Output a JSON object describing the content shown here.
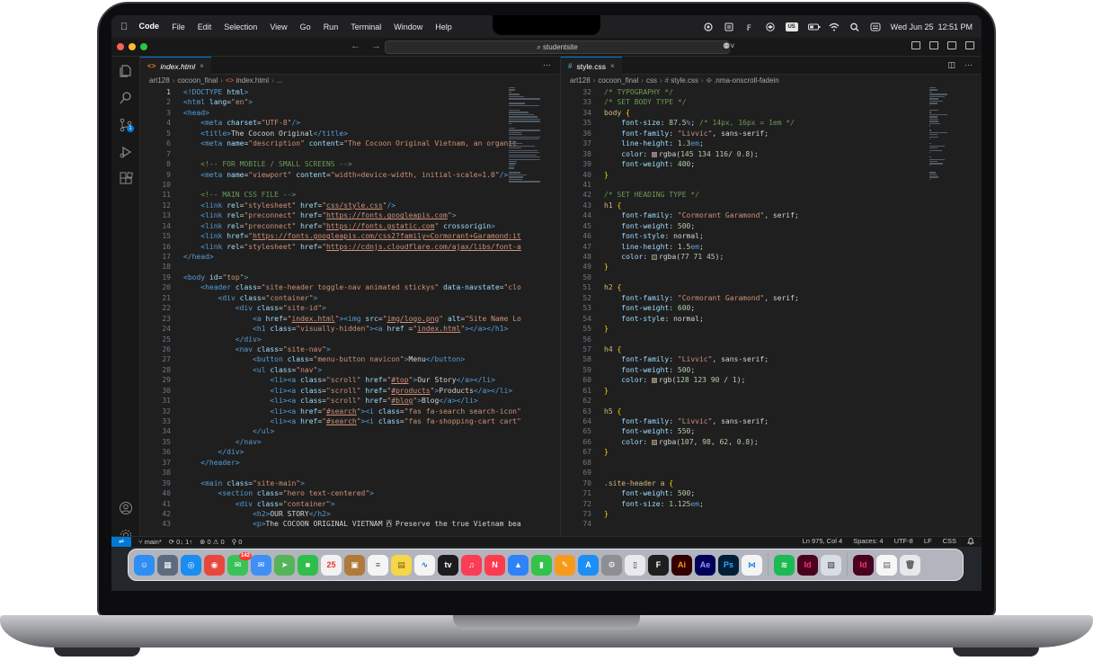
{
  "menubar": {
    "app_name": "Code",
    "menus": [
      "File",
      "Edit",
      "Selection",
      "View",
      "Go",
      "Run",
      "Terminal",
      "Window",
      "Help"
    ],
    "input_source": "US",
    "datetime": "Wed Jun 25  12:51 PM"
  },
  "titlebar": {
    "search_text": "studentsite",
    "back_glyph": "←",
    "forward_glyph": "→"
  },
  "left_editor": {
    "tab_label": "index.html",
    "tab_close": "×",
    "breadcrumb": [
      "art128",
      "cocoon_final",
      "index.html",
      "..."
    ],
    "current_line": 1,
    "lines": [
      {
        "n": 1,
        "html": "<span class='tg'>&lt;!DOCTYPE</span> <span class='at'>html</span><span class='tg'>&gt;</span>"
      },
      {
        "n": 2,
        "html": "<span class='tg'>&lt;html</span> <span class='at'>lang</span>=<span class='vs'>\"en\"</span><span class='tg'>&gt;</span>"
      },
      {
        "n": 3,
        "html": "<span class='tg'>&lt;head&gt;</span>"
      },
      {
        "n": 4,
        "html": "    <span class='tg'>&lt;meta</span> <span class='at'>charset</span>=<span class='vs'>\"UTF-8\"</span><span class='tg'>/&gt;</span>"
      },
      {
        "n": 5,
        "html": "    <span class='tg'>&lt;title&gt;</span>The Cocoon Original<span class='tg'>&lt;/title&gt;</span>"
      },
      {
        "n": 6,
        "html": "    <span class='tg'>&lt;meta</span> <span class='at'>name</span>=<span class='vs'>\"description\"</span> <span class='at'>content</span>=<span class='vs'>\"The Cocoon Original Vietnam, an organic</span>"
      },
      {
        "n": 7,
        "html": ""
      },
      {
        "n": 8,
        "html": "    <span class='cm'>&lt;!-- FOR MOBILE / SMALL SCREENS --&gt;</span>"
      },
      {
        "n": 9,
        "html": "    <span class='tg'>&lt;meta</span> <span class='at'>name</span>=<span class='vs'>\"viewport\"</span> <span class='at'>content</span>=<span class='vs'>\"width=device-width, initial-scale=1.0\"</span><span class='tg'>/&gt;</span>"
      },
      {
        "n": 10,
        "html": ""
      },
      {
        "n": 11,
        "html": "    <span class='cm'>&lt;!-- MAIN CSS FILE --&gt;</span>"
      },
      {
        "n": 12,
        "html": "    <span class='tg'>&lt;link</span> <span class='at'>rel</span>=<span class='vs'>\"stylesheet\"</span> <span class='at'>href</span>=<span class='vs'>\"<u>css/style.css</u>\"</span><span class='tg'>/&gt;</span>"
      },
      {
        "n": 13,
        "html": "    <span class='tg'>&lt;link</span> <span class='at'>rel</span>=<span class='vs'>\"preconnect\"</span> <span class='at'>href</span>=<span class='vs'>\"<u>https://fonts.googleapis.com</u>\"</span><span class='tg'>&gt;</span>"
      },
      {
        "n": 14,
        "html": "    <span class='tg'>&lt;link</span> <span class='at'>rel</span>=<span class='vs'>\"preconnect\"</span> <span class='at'>href</span>=<span class='vs'>\"<u>https://fonts.gstatic.com</u>\"</span> <span class='at'>crossorigin</span><span class='tg'>&gt;</span>"
      },
      {
        "n": 15,
        "html": "    <span class='tg'>&lt;link</span> <span class='at'>href</span>=<span class='vs'>\"<u>https://fonts.googleapis.com/css2?family=Cormorant+Garamond:it</u></span>"
      },
      {
        "n": 16,
        "html": "    <span class='tg'>&lt;link</span> <span class='at'>rel</span>=<span class='vs'>\"stylesheet\"</span> <span class='at'>href</span>=<span class='vs'>\"<u>https://cdnjs.cloudflare.com/ajax/libs/font-a</u></span>"
      },
      {
        "n": 17,
        "html": "<span class='tg'>&lt;/head&gt;</span>"
      },
      {
        "n": 18,
        "html": ""
      },
      {
        "n": 19,
        "html": "<span class='tg'>&lt;body</span> <span class='at'>id</span>=<span class='vs'>\"top\"</span><span class='tg'>&gt;</span>"
      },
      {
        "n": 20,
        "html": "    <span class='tg'>&lt;header</span> <span class='at'>class</span>=<span class='vs'>\"site-header toggle-nav animated stickys\"</span> <span class='at'>data-navstate</span>=<span class='vs'>\"clo</span>"
      },
      {
        "n": 21,
        "html": "        <span class='tg'>&lt;div</span> <span class='at'>class</span>=<span class='vs'>\"container\"</span><span class='tg'>&gt;</span>"
      },
      {
        "n": 22,
        "html": "            <span class='tg'>&lt;div</span> <span class='at'>class</span>=<span class='vs'>\"site-id\"</span><span class='tg'>&gt;</span>"
      },
      {
        "n": 23,
        "html": "                <span class='tg'>&lt;a</span> <span class='at'>href</span>=<span class='vs'>\"<u>index.html</u>\"</span><span class='tg'>&gt;&lt;img</span> <span class='at'>src</span>=<span class='vs'>\"<u>img/logo.png</u>\"</span> <span class='at'>alt</span>=<span class='vs'>\"Site Name Lo</span>"
      },
      {
        "n": 24,
        "html": "                <span class='tg'>&lt;h1</span> <span class='at'>class</span>=<span class='vs'>\"visually-hidden\"</span><span class='tg'>&gt;&lt;a</span> <span class='at'>href</span> =<span class='vs'>\"<u>index.html</u>\"</span><span class='tg'>&gt;&lt;/a&gt;&lt;/h1&gt;</span>"
      },
      {
        "n": 25,
        "html": "            <span class='tg'>&lt;/div&gt;</span>"
      },
      {
        "n": 26,
        "html": "            <span class='tg'>&lt;nav</span> <span class='at'>class</span>=<span class='vs'>\"site-nav\"</span><span class='tg'>&gt;</span>"
      },
      {
        "n": 27,
        "html": "                <span class='tg'>&lt;button</span> <span class='at'>class</span>=<span class='vs'>\"menu-button navicon\"</span><span class='tg'>&gt;</span>Menu<span class='tg'>&lt;/button&gt;</span>"
      },
      {
        "n": 28,
        "html": "                <span class='tg'>&lt;ul</span> <span class='at'>class</span>=<span class='vs'>\"nav\"</span><span class='tg'>&gt;</span>"
      },
      {
        "n": 29,
        "html": "                    <span class='tg'>&lt;li&gt;&lt;a</span> <span class='at'>class</span>=<span class='vs'>\"scroll\"</span> <span class='at'>href</span>=<span class='vs'>\"<u>#top</u>\"</span><span class='tg'>&gt;</span>Our Story<span class='tg'>&lt;/a&gt;&lt;/li&gt;</span>"
      },
      {
        "n": 30,
        "html": "                    <span class='tg'>&lt;li&gt;&lt;a</span> <span class='at'>class</span>=<span class='vs'>\"scroll\"</span> <span class='at'>href</span>=<span class='vs'>\"<u>#products</u>\"</span><span class='tg'>&gt;</span>Products<span class='tg'>&lt;/a&gt;&lt;/li&gt;</span>"
      },
      {
        "n": 31,
        "html": "                    <span class='tg'>&lt;li&gt;&lt;a</span> <span class='at'>class</span>=<span class='vs'>\"scroll\"</span> <span class='at'>href</span>=<span class='vs'>\"<u>#blog</u>\"</span><span class='tg'>&gt;</span>Blog<span class='tg'>&lt;/a&gt;&lt;/li&gt;</span>"
      },
      {
        "n": 32,
        "html": "                    <span class='tg'>&lt;li&gt;&lt;a</span> <span class='at'>href</span>=<span class='vs'>\"<u>#search</u>\"</span><span class='tg'>&gt;&lt;i</span> <span class='at'>class</span>=<span class='vs'>\"fas fa-search search-icon\"</span>"
      },
      {
        "n": 33,
        "html": "                    <span class='tg'>&lt;li&gt;&lt;a</span> <span class='at'>href</span>=<span class='vs'>\"<u>#search</u>\"</span><span class='tg'>&gt;&lt;i</span> <span class='at'>class</span>=<span class='vs'>\"fas fa-shopping-cart cart\"</span>"
      },
      {
        "n": 34,
        "html": "                <span class='tg'>&lt;/ul&gt;</span>"
      },
      {
        "n": 35,
        "html": "            <span class='tg'>&lt;/nav&gt;</span>"
      },
      {
        "n": 36,
        "html": "        <span class='tg'>&lt;/div&gt;</span>"
      },
      {
        "n": 37,
        "html": "    <span class='tg'>&lt;/header&gt;</span>"
      },
      {
        "n": 38,
        "html": ""
      },
      {
        "n": 39,
        "html": "    <span class='tg'>&lt;main</span> <span class='at'>class</span>=<span class='vs'>\"site-main\"</span><span class='tg'>&gt;</span>"
      },
      {
        "n": 40,
        "html": "        <span class='tg'>&lt;section</span> <span class='at'>class</span>=<span class='vs'>\"hero text-centered\"</span><span class='tg'>&gt;</span>"
      },
      {
        "n": 41,
        "html": "            <span class='tg'>&lt;div</span> <span class='at'>class</span>=<span class='vs'>\"container\"</span><span class='tg'>&gt;</span>"
      },
      {
        "n": 42,
        "html": "                <span class='tg'>&lt;h2&gt;</span>OUR STORY<span class='tg'>&lt;/h2&gt;</span>"
      },
      {
        "n": 43,
        "html": "                <span class='tg'>&lt;p&gt;</span>The COCOON ORIGINAL VIETNAM ⍓ Preserve the true Vietnam bea"
      }
    ]
  },
  "right_editor": {
    "tab_label": "style.css",
    "tab_close": "×",
    "breadcrumb": [
      "art128",
      "cocoon_final",
      "css",
      "style.css",
      ".nma-onscroll-fadein"
    ],
    "lines": [
      {
        "n": 32,
        "html": "<span class='cm'>/* TYPOGRAPHY */</span>"
      },
      {
        "n": 33,
        "html": "<span class='cm'>/* SET BODY TYPE */</span>"
      },
      {
        "n": 34,
        "html": "<span class='sel'>body</span> <span class='brace'>{</span>"
      },
      {
        "n": 35,
        "html": "    <span class='pr'>font-size</span>: <span class='nm'>87.5</span><span class='un'>%</span>; <span class='cm'>/* 14px, 16px = 1em */</span>"
      },
      {
        "n": 36,
        "html": "    <span class='pr'>font-family</span>: <span class='vs'>\"Livvic\"</span>, <span class='kw'>sans-serif</span>;"
      },
      {
        "n": 37,
        "html": "    <span class='pr'>line-height</span>: <span class='nm'>1.3</span><span class='un'>em</span>;"
      },
      {
        "n": 38,
        "html": "    <span class='pr'>color</span>: <span class='swatch' style='background:#917474'></span><span class='kw'>rgba</span>(<span class='nm'>145 134 116</span>/ <span class='nm'>0.8</span>);"
      },
      {
        "n": 39,
        "html": "    <span class='pr'>font-weight</span>: <span class='nm'>400</span>;"
      },
      {
        "n": 40,
        "html": "<span class='brace'>}</span>"
      },
      {
        "n": 41,
        "html": ""
      },
      {
        "n": 42,
        "html": "<span class='cm'>/* SET HEADING TYPE */</span>"
      },
      {
        "n": 43,
        "html": "<span class='sel'>h1</span> <span class='brace'>{</span>"
      },
      {
        "n": 44,
        "html": "    <span class='pr'>font-family</span>: <span class='vs'>\"Cormorant Garamond\"</span>, <span class='kw'>serif</span>;"
      },
      {
        "n": 45,
        "html": "    <span class='pr'>font-weight</span>: <span class='nm'>500</span>;"
      },
      {
        "n": 46,
        "html": "    <span class='pr'>font-style</span>: <span class='kw'>normal</span>;"
      },
      {
        "n": 47,
        "html": "    <span class='pr'>line-height</span>: <span class='nm'>1.5</span><span class='un'>em</span>;"
      },
      {
        "n": 48,
        "html": "    <span class='pr'>color</span>: <span class='swatch' style='background:#4d472d'></span><span class='kw'>rgba</span>(<span class='nm'>77 71 45</span>);"
      },
      {
        "n": 49,
        "html": "<span class='brace'>}</span>"
      },
      {
        "n": 50,
        "html": ""
      },
      {
        "n": 51,
        "html": "<span class='sel'>h2</span> <span class='brace'>{</span>"
      },
      {
        "n": 52,
        "html": "    <span class='pr'>font-family</span>: <span class='vs'>\"Cormorant Garamond\"</span>, <span class='kw'>serif</span>;"
      },
      {
        "n": 53,
        "html": "    <span class='pr'>font-weight</span>: <span class='nm'>600</span>;"
      },
      {
        "n": 54,
        "html": "    <span class='pr'>font-style</span>: <span class='kw'>normal</span>;"
      },
      {
        "n": 55,
        "html": "<span class='brace'>}</span>"
      },
      {
        "n": 56,
        "html": ""
      },
      {
        "n": 57,
        "html": "<span class='sel'>h4</span> <span class='brace'>{</span>"
      },
      {
        "n": 58,
        "html": "    <span class='pr'>font-family</span>: <span class='vs'>\"Livvic\"</span>, <span class='kw'>sans-serif</span>;"
      },
      {
        "n": 59,
        "html": "    <span class='pr'>font-weight</span>: <span class='nm'>500</span>;"
      },
      {
        "n": 60,
        "html": "    <span class='pr'>color</span>: <span class='swatch' style='background:#807b5a'></span><span class='kw'>rgb</span>(<span class='nm'>128 123 90</span> / <span class='nm'>1</span>);"
      },
      {
        "n": 61,
        "html": "<span class='brace'>}</span>"
      },
      {
        "n": 62,
        "html": ""
      },
      {
        "n": 63,
        "html": "<span class='sel'>h5</span> <span class='brace'>{</span>"
      },
      {
        "n": 64,
        "html": "    <span class='pr'>font-family</span>: <span class='vs'>\"Livvic\"</span>, <span class='kw'>sans-serif</span>;"
      },
      {
        "n": 65,
        "html": "    <span class='pr'>font-weight</span>: <span class='nm'>550</span>;"
      },
      {
        "n": 66,
        "html": "    <span class='pr'>color</span>: <span class='swatch' style='background:#6b623e'></span><span class='kw'>rgba</span>(<span class='nm'>107</span>, <span class='nm'>98</span>, <span class='nm'>62</span>, <span class='nm'>0.8</span>);"
      },
      {
        "n": 67,
        "html": "<span class='brace'>}</span>"
      },
      {
        "n": 68,
        "html": ""
      },
      {
        "n": 69,
        "html": ""
      },
      {
        "n": 70,
        "html": "<span class='sel'>.site-header a</span> <span class='brace'>{</span>"
      },
      {
        "n": 71,
        "html": "    <span class='pr'>font-weight</span>: <span class='nm'>500</span>;"
      },
      {
        "n": 72,
        "html": "    <span class='pr'>font-size</span>: <span class='nm'>1.125</span><span class='un'>em</span>;"
      },
      {
        "n": 73,
        "html": "<span class='brace'>}</span>"
      },
      {
        "n": 74,
        "html": ""
      }
    ]
  },
  "statusbar": {
    "remote": "⇌",
    "branch": "main*",
    "sync": "⟳ 0↓ 1↑",
    "problems": "⊗ 0 ⚠ 0",
    "ports": "⚲ 0",
    "cursor": "Ln 975, Col 4",
    "spaces": "Spaces: 4",
    "encoding": "UTF-8",
    "eol": "LF",
    "language": "CSS",
    "bell": "🔔"
  },
  "dock": {
    "apps": [
      {
        "name": "finder",
        "glyph": "☺",
        "color": "#2f8ef5"
      },
      {
        "name": "launchpad",
        "glyph": "▦",
        "color": "#5d6b7f"
      },
      {
        "name": "safari",
        "glyph": "◎",
        "color": "#1b8cf0"
      },
      {
        "name": "chrome",
        "glyph": "◉",
        "color": "#e8473d"
      },
      {
        "name": "messages",
        "glyph": "✉",
        "color": "#3ac259",
        "badge": "142"
      },
      {
        "name": "mail",
        "glyph": "✉",
        "color": "#3f8ff6"
      },
      {
        "name": "maps",
        "glyph": "➤",
        "color": "#56b35a"
      },
      {
        "name": "facetime",
        "glyph": "■",
        "color": "#2fbe4c"
      },
      {
        "name": "calendar",
        "glyph": "25",
        "color": "#f2f2f2",
        "text": "#e33"
      },
      {
        "name": "notefile",
        "glyph": "▣",
        "color": "#b07a3a"
      },
      {
        "name": "reminders",
        "glyph": "≡",
        "color": "#f4f4f4",
        "text": "#555"
      },
      {
        "name": "notes",
        "glyph": "▤",
        "color": "#f7d54a",
        "text": "#7a5b00"
      },
      {
        "name": "freeform",
        "glyph": "∿",
        "color": "#f4f4f4",
        "text": "#2a6fd6"
      },
      {
        "name": "appletv",
        "glyph": "tv",
        "color": "#1c1c1e"
      },
      {
        "name": "music",
        "glyph": "♫",
        "color": "#fa3c55"
      },
      {
        "name": "news",
        "glyph": "N",
        "color": "#ff3b4e"
      },
      {
        "name": "keynote",
        "glyph": "▲",
        "color": "#2d83f7"
      },
      {
        "name": "numbers",
        "glyph": "▮",
        "color": "#34c34a"
      },
      {
        "name": "pages",
        "glyph": "✎",
        "color": "#f79a1b"
      },
      {
        "name": "appstore",
        "glyph": "A",
        "color": "#1d8ef5"
      },
      {
        "name": "settings",
        "glyph": "⚙",
        "color": "#8e8e93"
      },
      {
        "name": "iphone-mirroring",
        "glyph": "▯",
        "color": "#e9e9ee",
        "text": "#333"
      },
      {
        "name": "figma",
        "glyph": "F",
        "color": "#1e1e1e"
      },
      {
        "name": "illustrator",
        "glyph": "Ai",
        "color": "#330000",
        "text": "#ff9a00"
      },
      {
        "name": "aftereffects",
        "glyph": "Ae",
        "color": "#00005b",
        "text": "#9999ff"
      },
      {
        "name": "photoshop",
        "glyph": "Ps",
        "color": "#001e36",
        "text": "#31a8ff"
      },
      {
        "name": "vscode",
        "glyph": "⋈",
        "color": "#f4f4f4",
        "text": "#1e88e5"
      },
      {
        "name": "sep"
      },
      {
        "name": "spotify",
        "glyph": "≋",
        "color": "#1db954"
      },
      {
        "name": "indesign",
        "glyph": "Id",
        "color": "#49021f",
        "text": "#ff3366"
      },
      {
        "name": "preview",
        "glyph": "▧",
        "color": "#d9dde4",
        "text": "#333"
      },
      {
        "name": "sep"
      },
      {
        "name": "indd-file",
        "glyph": "Id",
        "color": "#49021f",
        "text": "#ff3366"
      },
      {
        "name": "document-file",
        "glyph": "▤",
        "color": "#f6f6f6",
        "text": "#666"
      },
      {
        "name": "trash",
        "glyph": "🗑",
        "color": "#e6e8ec",
        "text": "#555"
      }
    ]
  },
  "colors": {
    "editor_bg": "#1f1f1f",
    "accent": "#0078d4"
  }
}
